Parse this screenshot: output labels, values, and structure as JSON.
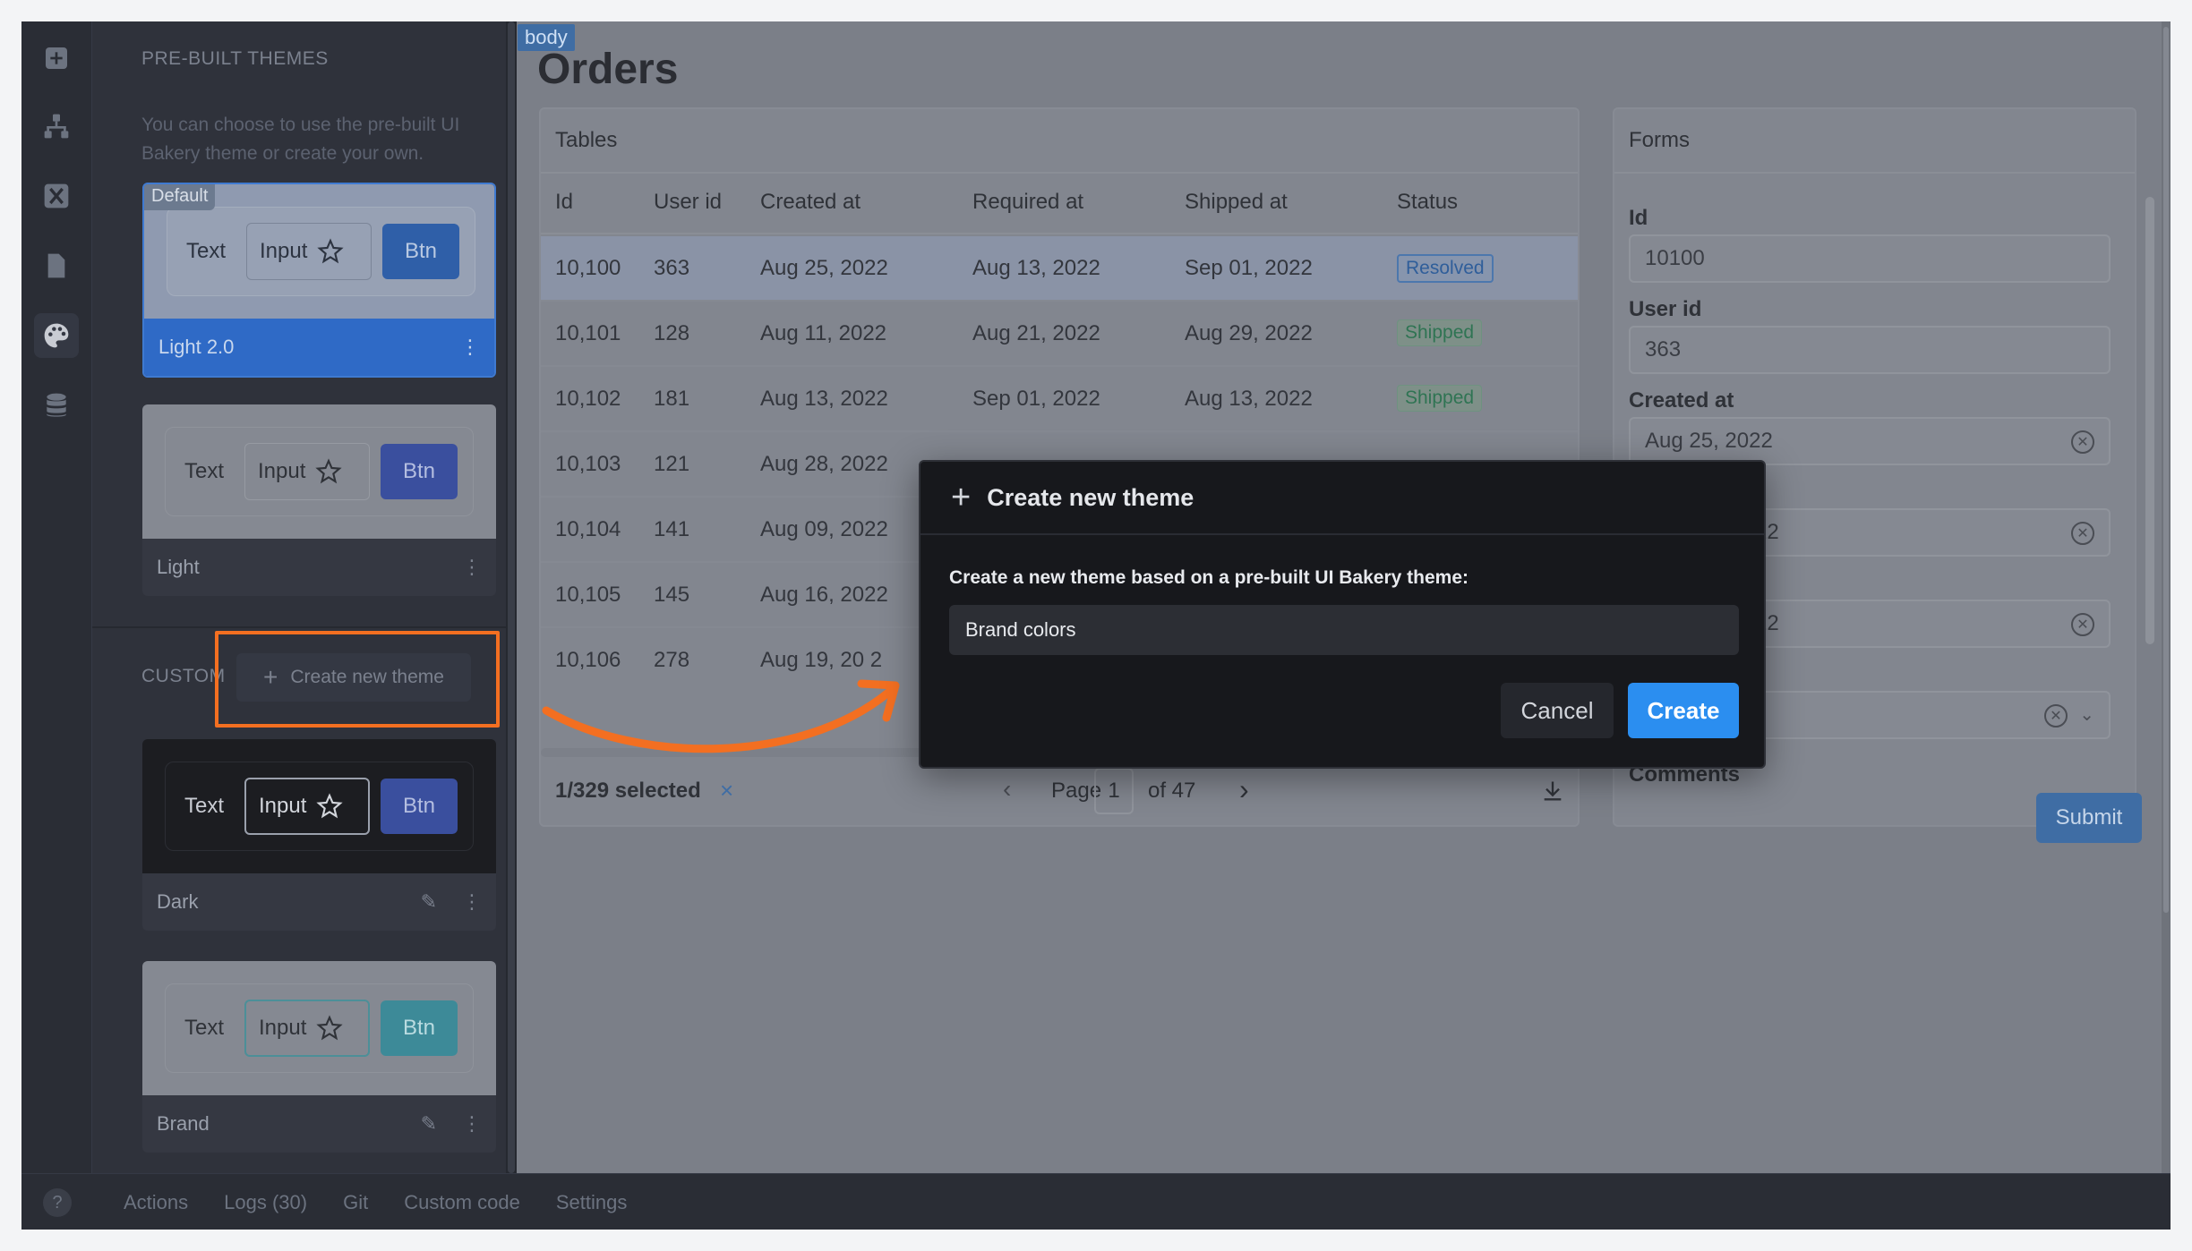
{
  "sidebar": {
    "prebuilt_title": "PRE-BUILT THEMES",
    "prebuilt_desc": "You can choose to use the pre-built UI Bakery theme or create your own.",
    "default_badge": "Default",
    "custom_title": "CUSTOM",
    "create_new_theme_label": "Create new theme",
    "preview_text": "Text",
    "preview_input": "Input",
    "preview_btn": "Btn",
    "themes": [
      {
        "name": "Light 2.0"
      },
      {
        "name": "Light"
      },
      {
        "name": "Dark"
      },
      {
        "name": "Brand"
      }
    ]
  },
  "canvas": {
    "body_tag": "body",
    "page_title": "Orders",
    "tables": {
      "title": "Tables",
      "columns": [
        "Id",
        "User id",
        "Created at",
        "Required at",
        "Shipped at",
        "Status"
      ],
      "rows": [
        [
          "10,100",
          "363",
          "Aug 25, 2022",
          "Aug 13, 2022",
          "Sep 01, 2022",
          "Resolved"
        ],
        [
          "10,101",
          "128",
          "Aug 11, 2022",
          "Aug 21, 2022",
          "Aug 29, 2022",
          "Shipped"
        ],
        [
          "10,102",
          "181",
          "Aug 13, 2022",
          "Sep 01, 2022",
          "Aug 13, 2022",
          "Shipped"
        ],
        [
          "10,103",
          "121",
          "Aug 28, 2022",
          "",
          "",
          ""
        ],
        [
          "10,104",
          "141",
          "Aug 09, 2022",
          "",
          "",
          ""
        ],
        [
          "10,105",
          "145",
          "Aug 16, 2022",
          "",
          "",
          ""
        ],
        [
          "10,106",
          "278",
          "Aug 19, 20 2",
          "",
          "",
          ""
        ]
      ],
      "selected_text": "1/329 selected",
      "clear_selection": "×",
      "page_label": "Page",
      "page_current": "1",
      "page_of": "of 47"
    },
    "forms": {
      "title": "Forms",
      "id_label": "Id",
      "id_value": "10100",
      "user_id_label": "User id",
      "user_id_value": "363",
      "created_at_label": "Created at",
      "created_at_value": "Aug 25, 2022",
      "required_partial": "22",
      "shipped_partial": "22",
      "comments_label": "Comments",
      "submit_label": "Submit"
    }
  },
  "bottombar": {
    "help": "?",
    "tabs": [
      "Actions",
      "Logs (30)",
      "Git",
      "Custom code",
      "Settings"
    ]
  },
  "modal": {
    "title": "Create new theme",
    "label": "Create a new theme based on a pre-built UI Bakery theme:",
    "select_value": "Brand colors",
    "cancel_label": "Cancel",
    "create_label": "Create"
  },
  "colors": {
    "accent": "#2b8ef0",
    "highlight": "#f36f21",
    "selected_theme": "#2f6ac6"
  },
  "icons": [
    "add-icon",
    "tree-icon",
    "function-icon",
    "page-icon",
    "palette-icon",
    "database-icon",
    "star-icon",
    "more-icon",
    "pencil-icon",
    "plus-icon",
    "chevron-left-icon",
    "chevron-right-icon",
    "download-icon",
    "clear-icon",
    "chevron-down-icon",
    "help-icon"
  ]
}
